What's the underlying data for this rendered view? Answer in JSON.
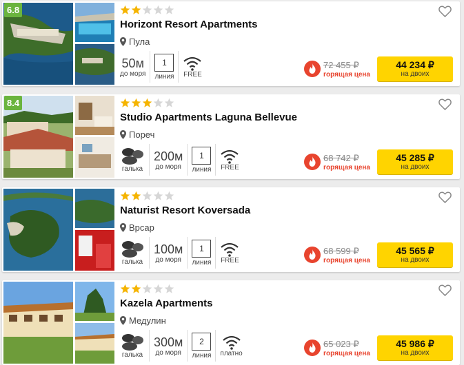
{
  "colors": {
    "accent": "#ffd400",
    "rating_bg": "#6ab43e",
    "star_on": "#f5b400",
    "star_off": "#d6d6d6",
    "hot": "#e8442e"
  },
  "hotels": [
    {
      "rating": "6.8",
      "stars": 2,
      "name": "Horizont Resort Apartments",
      "location": "Пула",
      "beach_type": "",
      "distance_value": "50",
      "distance_unit": "м",
      "distance_label": "до моря",
      "line_number": "1",
      "line_label": "линия",
      "wifi_label": "FREE",
      "old_price": "72 455 ₽",
      "hot_label": "горящая цена",
      "price": "44 234 ₽",
      "price_sub": "на двоих"
    },
    {
      "rating": "8.4",
      "stars": 3,
      "name": "Studio Apartments Laguna Bellevue",
      "location": "Пореч",
      "beach_type": "галька",
      "distance_value": "200",
      "distance_unit": "м",
      "distance_label": "до моря",
      "line_number": "1",
      "line_label": "линия",
      "wifi_label": "FREE",
      "old_price": "68 742 ₽",
      "hot_label": "горящая цена",
      "price": "45 285 ₽",
      "price_sub": "на двоих"
    },
    {
      "rating": "",
      "stars": 2,
      "name": "Naturist Resort Koversada",
      "location": "Врсар",
      "beach_type": "галька",
      "distance_value": "100",
      "distance_unit": "м",
      "distance_label": "до моря",
      "line_number": "1",
      "line_label": "линия",
      "wifi_label": "FREE",
      "old_price": "68 599 ₽",
      "hot_label": "горящая цена",
      "price": "45 565 ₽",
      "price_sub": "на двоих"
    },
    {
      "rating": "",
      "stars": 2,
      "name": "Kazela Apartments",
      "location": "Медулин",
      "beach_type": "галька",
      "distance_value": "300",
      "distance_unit": "м",
      "distance_label": "до моря",
      "line_number": "2",
      "line_label": "линия",
      "wifi_label": "платно",
      "old_price": "65 023 ₽",
      "hot_label": "горящая цена",
      "price": "45 986 ₽",
      "price_sub": "на двоих"
    }
  ]
}
